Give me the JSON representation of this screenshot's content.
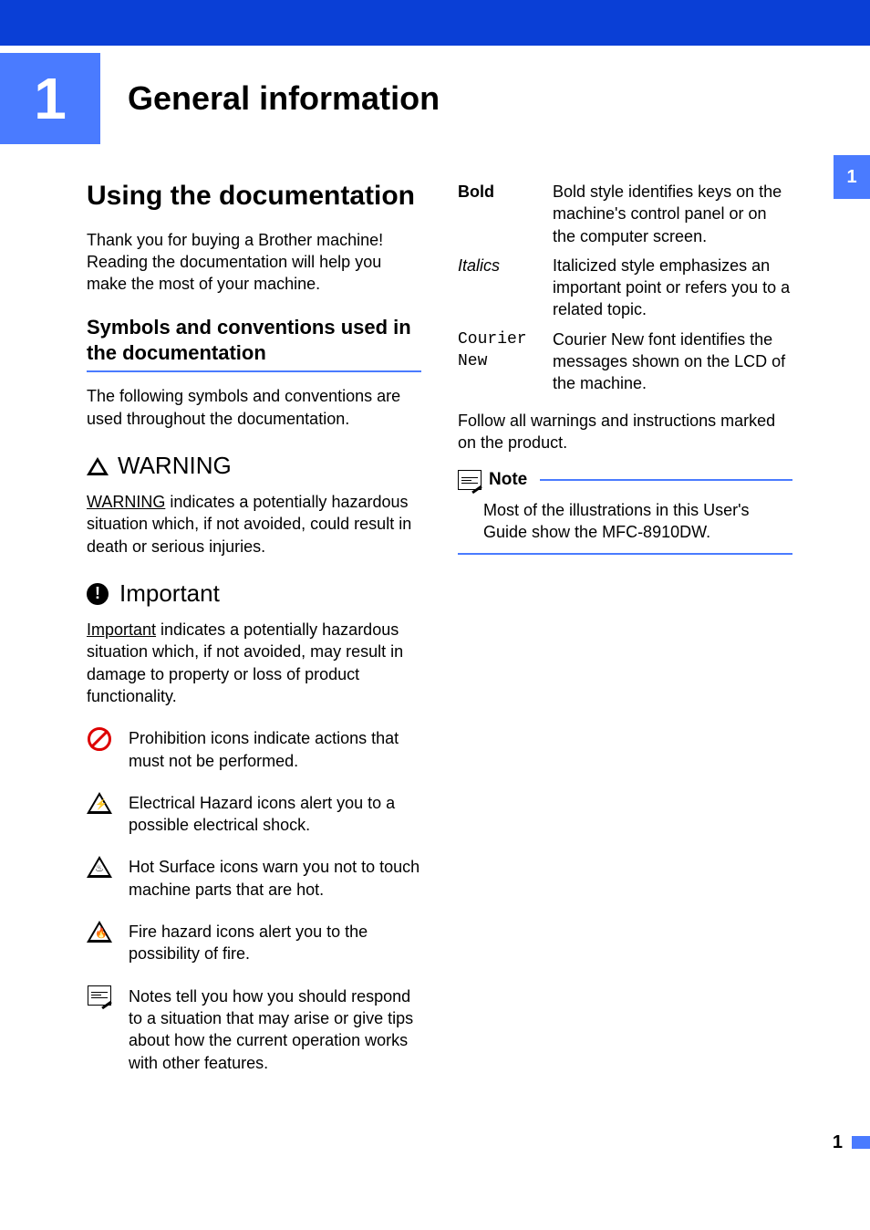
{
  "chapter": {
    "number": "1",
    "title": "General information"
  },
  "side_tab": "1",
  "section_title": "Using the documentation",
  "intro_p": "Thank you for buying a Brother machine! Reading the documentation will help you make the most of your machine.",
  "sub_title": "Symbols and conventions used in the documentation",
  "sub_intro": "The following symbols and conventions are used throughout the documentation.",
  "warning": {
    "label": "WARNING",
    "key": "WARNING",
    "rest": " indicates a potentially hazardous situation which, if not avoided, could result in death or serious injuries."
  },
  "important": {
    "label": "Important",
    "key": "Important",
    "rest": " indicates a potentially hazardous situation which, if not avoided, may result in damage to property or loss of product functionality."
  },
  "icons": {
    "prohibit": "Prohibition icons indicate actions that must not be performed.",
    "electric": "Electrical Hazard icons alert you to a possible electrical shock.",
    "hot": "Hot Surface icons warn you not to touch machine parts that are hot.",
    "fire": "Fire hazard icons alert you to the possibility of fire.",
    "notes": "Notes tell you how you should respond to a situation that may arise or give tips about how the current operation works with other features."
  },
  "typo": {
    "bold_k": "Bold",
    "bold_v": "Bold style identifies keys on the machine's control panel or on the computer screen.",
    "ital_k": "Italics",
    "ital_v": "Italicized style emphasizes an important point or refers you to a related topic.",
    "mono_k": "Courier New",
    "mono_v": "Courier New font identifies the messages shown on the LCD of the machine."
  },
  "follow_p": "Follow all warnings and instructions marked on the product.",
  "note_box": {
    "label": "Note",
    "body": "Most of the illustrations in this User's Guide show the MFC-8910DW."
  },
  "page_number": "1"
}
